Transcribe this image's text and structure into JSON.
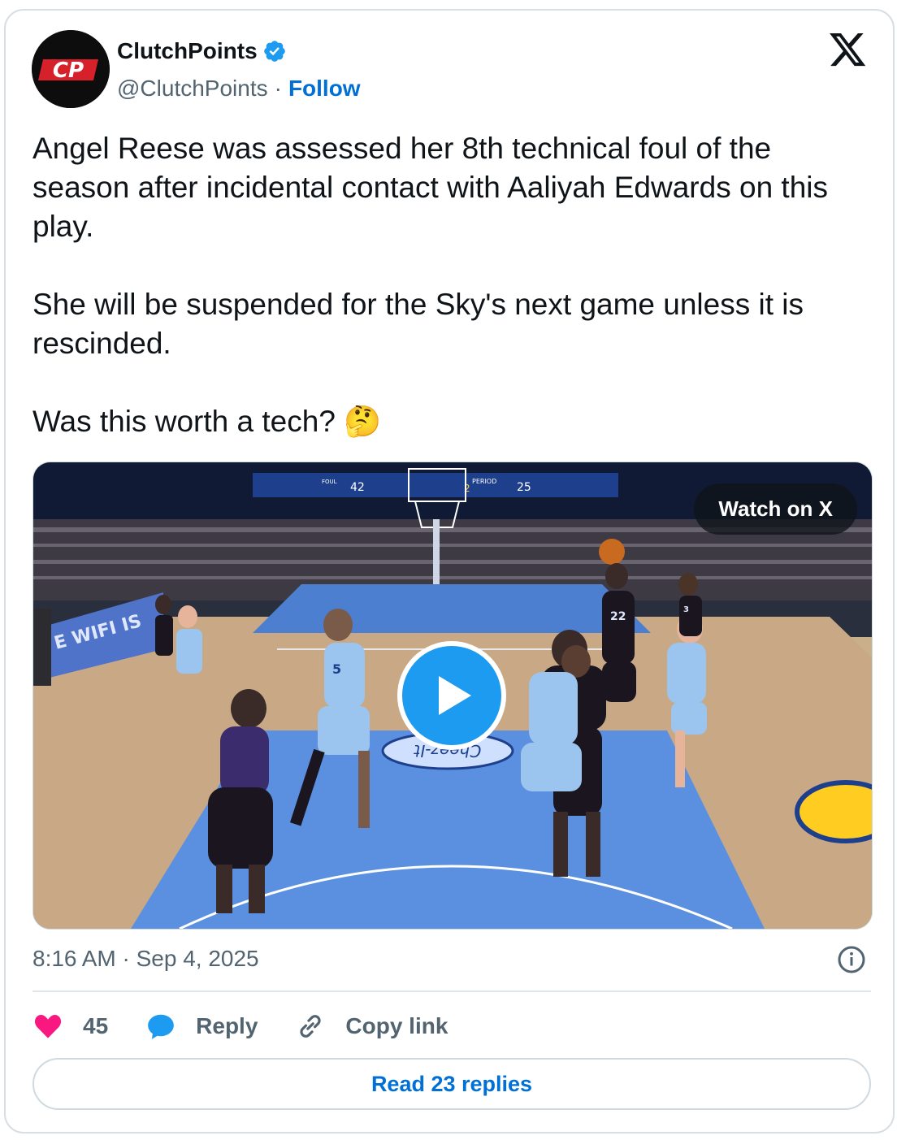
{
  "author": {
    "name": "ClutchPoints",
    "handle": "@ClutchPoints",
    "separator": "·",
    "follow_label": "Follow",
    "avatar_text": "CP"
  },
  "tweet": {
    "paragraphs": [
      "Angel Reese was assessed her 8th technical foul of the season after incidental contact with Aaliyah Edwards on this play.",
      "She will be suspended for the Sky's next game unless it is rescinded.",
      "Was this worth a tech? 🤔"
    ]
  },
  "media": {
    "watch_label": "Watch on X",
    "scoreboard": {
      "left_score": "42",
      "right_score": "25",
      "period": "2",
      "foul_label": "FOUL",
      "period_label": "PERIOD"
    },
    "court_text": "Cheez-It",
    "ad_text": "E WIFI IS",
    "jersey_numbers": [
      "22",
      "5",
      "3"
    ]
  },
  "timestamp": "8:16 AM · Sep 4, 2025",
  "actions": {
    "likes_count": "45",
    "reply_label": "Reply",
    "copy_label": "Copy link"
  },
  "read_replies_label": "Read 23 replies",
  "colors": {
    "accent": "#006fd6",
    "like": "#f91880",
    "reply": "#1d9bf0",
    "verified": "#1d9bf0",
    "court_blue": "#5b8fe0"
  }
}
